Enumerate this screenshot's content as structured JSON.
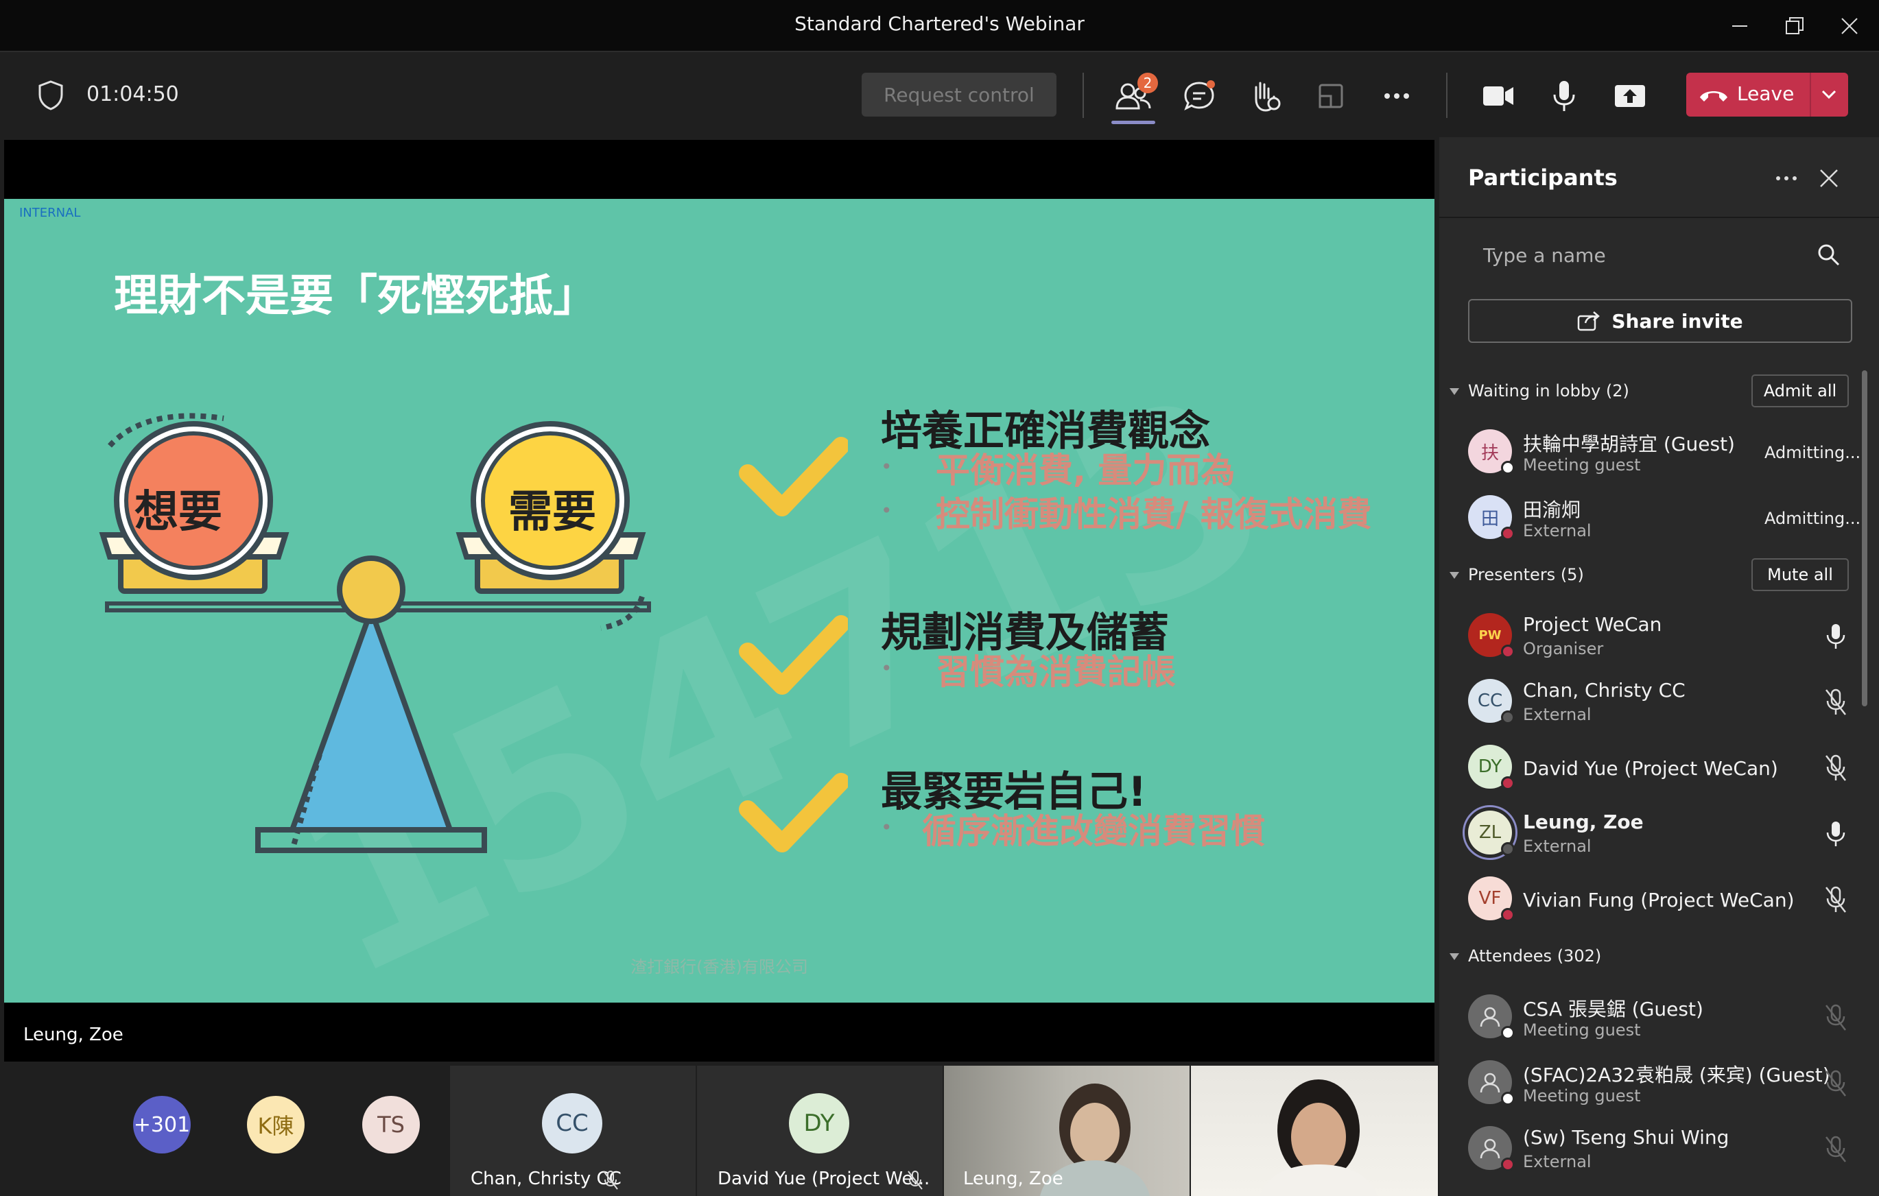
{
  "window": {
    "title": "Standard Chartered's Webinar"
  },
  "toolbar": {
    "timer": "01:04:50",
    "request_control": "Request control",
    "participants_badge": "2",
    "leave_label": "Leave"
  },
  "slide": {
    "tag": "INTERNAL",
    "title": "理財不是要「死慳死抵」",
    "left_pan": "想要",
    "right_pan": "需要",
    "items": [
      {
        "heading": "培養正確消費觀念",
        "bullets": [
          "平衡消費, 量力而為",
          "控制衝動性消費/ 報復式消費"
        ]
      },
      {
        "heading": "規劃消費及儲蓄",
        "bullets": [
          "習慣為消費記帳"
        ]
      },
      {
        "heading": "最緊要岩自己!",
        "bullets": [
          "循序漸進改變消費習慣"
        ]
      }
    ],
    "footer": "渣打銀行(香港)有限公司",
    "watermark": "154713"
  },
  "stage": {
    "presenter_name": "Leung, Zoe"
  },
  "panel": {
    "title": "Participants",
    "search_placeholder": "Type a name",
    "share_invite": "Share invite",
    "lobby": {
      "header": "Waiting in lobby (2)",
      "action": "Admit all",
      "people": [
        {
          "initials": "扶",
          "name": "扶輪中學胡詩宜 (Guest)",
          "role": "Meeting guest",
          "status": "Admitting..."
        },
        {
          "initials": "田",
          "name": "田渝炯",
          "role": "External",
          "status": "Admitting..."
        }
      ]
    },
    "presenters": {
      "header": "Presenters (5)",
      "action": "Mute all",
      "people": [
        {
          "initials": "PW",
          "name": "Project WeCan",
          "role": "Organiser"
        },
        {
          "initials": "CC",
          "name": "Chan, Christy CC",
          "role": "External"
        },
        {
          "initials": "DY",
          "name": "David Yue (Project WeCan)",
          "role": ""
        },
        {
          "initials": "ZL",
          "name": "Leung, Zoe",
          "role": "External"
        },
        {
          "initials": "VF",
          "name": "Vivian Fung (Project WeCan)",
          "role": ""
        }
      ]
    },
    "attendees": {
      "header": "Attendees (302)",
      "people": [
        {
          "name": "CSA 張昊鋸 (Guest)",
          "role": "Meeting guest"
        },
        {
          "name": "(SFAC)2A32袁粕晟 (来宾) (Guest)",
          "role": "Meeting guest"
        },
        {
          "name": "(Sw) Tseng Shui Wing",
          "role": "External"
        }
      ]
    }
  },
  "strip": {
    "more_count": "+301",
    "k_initials": "K陳",
    "ts_initials": "TS",
    "tiles": [
      {
        "initials": "CC",
        "name": "Chan, Christy CC"
      },
      {
        "initials": "DY",
        "name": "David Yue (Project We..."
      },
      {
        "initials": "",
        "name": "Leung, Zoe"
      },
      {
        "initials": "",
        "name": ""
      }
    ]
  },
  "colors": {
    "accent": "#6264a7",
    "leave": "#c4314b",
    "slide_bg": "#5fc4a8",
    "check": "#f3c43c"
  }
}
